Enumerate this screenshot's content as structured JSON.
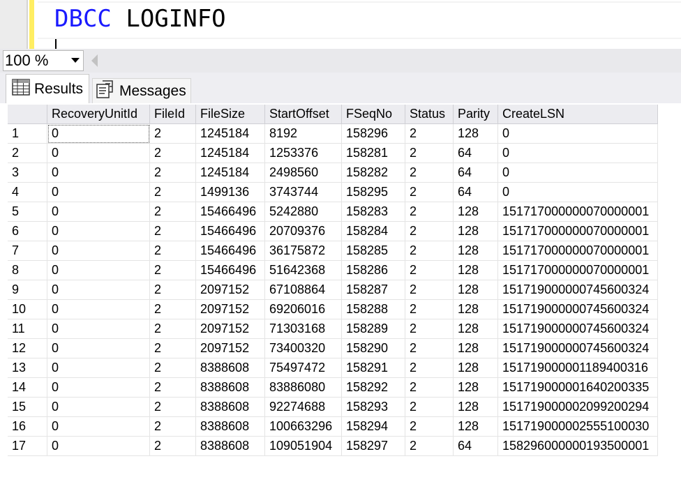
{
  "editor": {
    "keyword": "DBCC",
    "rest": " LOGINFO"
  },
  "zoom": {
    "value": "100 %"
  },
  "tabs": [
    {
      "label": "Results",
      "icon": "grid-icon"
    },
    {
      "label": "Messages",
      "icon": "messages-icon"
    }
  ],
  "grid": {
    "columns": [
      "",
      "RecoveryUnitId",
      "FileId",
      "FileSize",
      "StartOffset",
      "FSeqNo",
      "Status",
      "Parity",
      "CreateLSN"
    ],
    "rows": [
      [
        "1",
        "0",
        "2",
        "1245184",
        "8192",
        "158296",
        "2",
        "128",
        "0"
      ],
      [
        "2",
        "0",
        "2",
        "1245184",
        "1253376",
        "158281",
        "2",
        "64",
        "0"
      ],
      [
        "3",
        "0",
        "2",
        "1245184",
        "2498560",
        "158282",
        "2",
        "64",
        "0"
      ],
      [
        "4",
        "0",
        "2",
        "1499136",
        "3743744",
        "158295",
        "2",
        "64",
        "0"
      ],
      [
        "5",
        "0",
        "2",
        "15466496",
        "5242880",
        "158283",
        "2",
        "128",
        "151717000000070000001"
      ],
      [
        "6",
        "0",
        "2",
        "15466496",
        "20709376",
        "158284",
        "2",
        "128",
        "151717000000070000001"
      ],
      [
        "7",
        "0",
        "2",
        "15466496",
        "36175872",
        "158285",
        "2",
        "128",
        "151717000000070000001"
      ],
      [
        "8",
        "0",
        "2",
        "15466496",
        "51642368",
        "158286",
        "2",
        "128",
        "151717000000070000001"
      ],
      [
        "9",
        "0",
        "2",
        "2097152",
        "67108864",
        "158287",
        "2",
        "128",
        "151719000000745600324"
      ],
      [
        "10",
        "0",
        "2",
        "2097152",
        "69206016",
        "158288",
        "2",
        "128",
        "151719000000745600324"
      ],
      [
        "11",
        "0",
        "2",
        "2097152",
        "71303168",
        "158289",
        "2",
        "128",
        "151719000000745600324"
      ],
      [
        "12",
        "0",
        "2",
        "2097152",
        "73400320",
        "158290",
        "2",
        "128",
        "151719000000745600324"
      ],
      [
        "13",
        "0",
        "2",
        "8388608",
        "75497472",
        "158291",
        "2",
        "128",
        "151719000001189400316"
      ],
      [
        "14",
        "0",
        "2",
        "8388608",
        "83886080",
        "158292",
        "2",
        "128",
        "151719000001640200335"
      ],
      [
        "15",
        "0",
        "2",
        "8388608",
        "92274688",
        "158293",
        "2",
        "128",
        "151719000002099200294"
      ],
      [
        "16",
        "0",
        "2",
        "8388608",
        "100663296",
        "158294",
        "2",
        "128",
        "151719000002555100030"
      ],
      [
        "17",
        "0",
        "2",
        "8388608",
        "109051904",
        "158297",
        "2",
        "64",
        "158296000000193500001"
      ]
    ]
  },
  "colors": {
    "keyword": "#1a1aff",
    "gutter_marker": "#ffee62"
  }
}
